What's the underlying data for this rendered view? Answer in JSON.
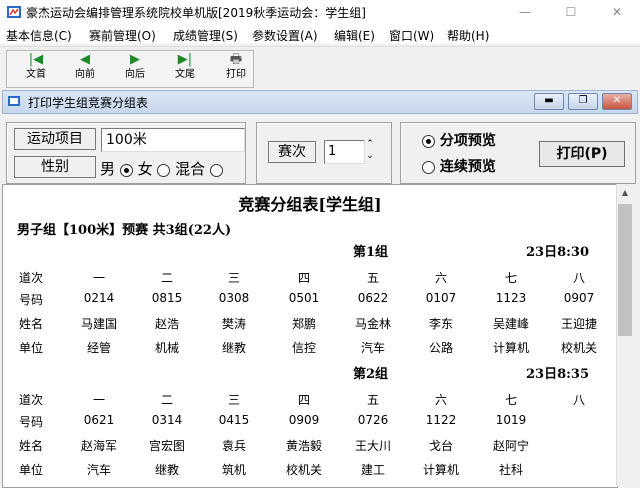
{
  "window": {
    "title": "豪杰运动会编排管理系统院校单机版[2019秋季运动会：学生组]"
  },
  "menu": [
    "基本信息(C)",
    "赛前管理(O)",
    "成绩管理(S)",
    "参数设置(A)",
    "编辑(E)",
    "窗口(W)",
    "帮助(H)"
  ],
  "toolbar": [
    {
      "label": "文首",
      "icon": "first-icon"
    },
    {
      "label": "向前",
      "icon": "prev-icon"
    },
    {
      "label": "向后",
      "icon": "next-icon"
    },
    {
      "label": "文尾",
      "icon": "last-icon"
    },
    {
      "label": "打印",
      "icon": "printer-icon"
    }
  ],
  "child": {
    "title": "打印学生组竞赛分组表"
  },
  "options": {
    "event_label": "运动项目",
    "event_value": "100米",
    "gender_label": "性别",
    "gender_options": [
      "男",
      "女",
      "混合"
    ],
    "gender_selected": "女",
    "round_label": "赛次",
    "round_value": "1",
    "preview_options": [
      "分项预览",
      "连续预览"
    ],
    "preview_selected": "分项预览",
    "print_label": "打印(P)"
  },
  "report": {
    "title": "竞赛分组表[学生组]",
    "subtitle": "男子组【100米】预赛    共3组(22人)",
    "row_labels": [
      "道次",
      "号码",
      "姓名",
      "单位"
    ],
    "lanes": [
      "一",
      "二",
      "三",
      "四",
      "五",
      "六",
      "七",
      "八"
    ],
    "groups": [
      {
        "name": "第1组",
        "time": "23日8:30",
        "numbers": [
          "0214",
          "0815",
          "0308",
          "0501",
          "0622",
          "0107",
          "1123",
          "0907"
        ],
        "names": [
          "马建国",
          "赵浩",
          "樊涛",
          "郑鹏",
          "马金林",
          "李东",
          "吴建峰",
          "王迎捷"
        ],
        "units": [
          "经管",
          "机械",
          "继教",
          "信控",
          "汽车",
          "公路",
          "计算机",
          "校机关"
        ]
      },
      {
        "name": "第2组",
        "time": "23日8:35",
        "numbers": [
          "0621",
          "0314",
          "0415",
          "0909",
          "0726",
          "1122",
          "1019",
          ""
        ],
        "names": [
          "赵海军",
          "宫宏图",
          "袁兵",
          "黄浩毅",
          "王大川",
          "戈台",
          "赵阿宁",
          ""
        ],
        "units": [
          "汽车",
          "继教",
          "筑机",
          "校机关",
          "建工",
          "计算机",
          "社科",
          ""
        ]
      }
    ]
  }
}
